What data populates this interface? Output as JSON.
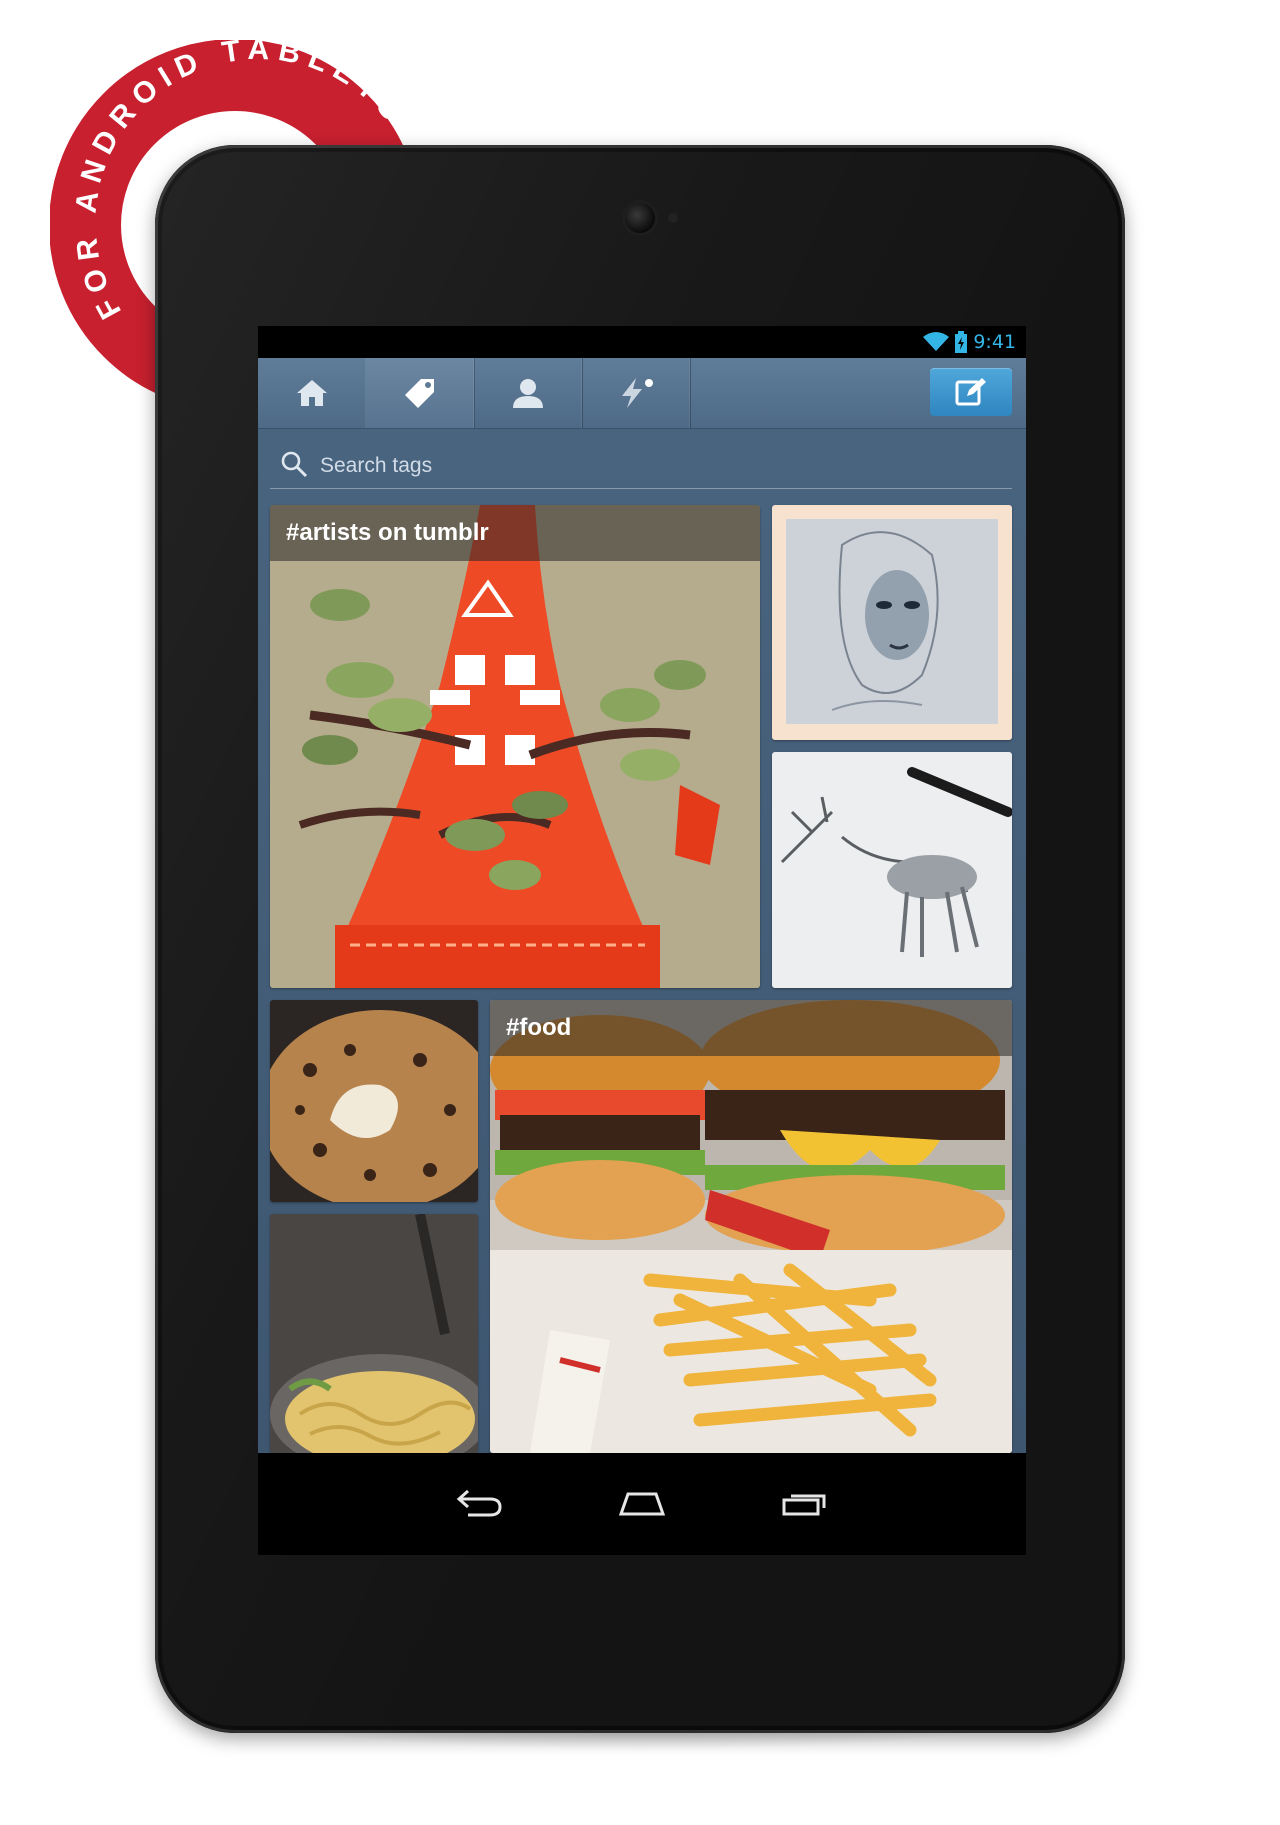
{
  "badge": {
    "text": "FOR ANDROID TABLETS",
    "color": "#c8202f"
  },
  "status_bar": {
    "time": "9:41",
    "accent": "#33b5e5"
  },
  "nav_tabs": [
    {
      "icon": "home-icon",
      "active": false
    },
    {
      "icon": "tag-icon",
      "active": true
    },
    {
      "icon": "user-icon",
      "active": false
    },
    {
      "icon": "activity-icon",
      "active": false
    }
  ],
  "compose": {
    "icon": "compose-icon",
    "color": "#3a96cf"
  },
  "search": {
    "placeholder": "Search tags"
  },
  "tiles": {
    "artists": {
      "label": "#artists on tumblr"
    },
    "food": {
      "label": "#food"
    }
  },
  "system_nav": [
    "back-icon",
    "home-icon",
    "recent-apps-icon"
  ]
}
